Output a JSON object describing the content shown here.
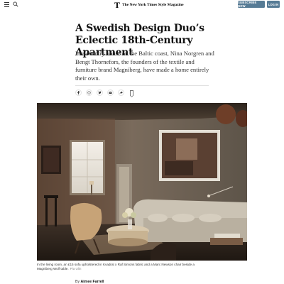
{
  "header": {
    "menu_icon": "hamburger-icon",
    "search_icon": "search-icon",
    "logo_letter": "T",
    "masthead": "The New York Times Style Magazine",
    "subscribe_label": "SUBSCRIBE NOW",
    "login_label": "LOG IN",
    "button_color": "#567b95"
  },
  "article": {
    "headline": "A Swedish Design Duo’s Eclectic 18th-Century Apartment",
    "summary": "In a country house on the Baltic coast, Nina Norgren and Bengt Thornefors, the founders of the textile and furniture brand Magniberg, have made a home entirely their own.",
    "share": [
      "facebook-icon",
      "whatsapp-icon",
      "twitter-icon",
      "email-icon",
      "share-icon",
      "bookmark-icon"
    ],
    "photo": {
      "caption": "In the living room, an £15 sofa upholstered in Kvadrat x Raf Simons fabric and a Marc Newson chair beside a Magniberg Wolf table.",
      "credit": "Pia Ulin"
    },
    "byline_prefix": "By",
    "author": "Aimee Farrell"
  }
}
